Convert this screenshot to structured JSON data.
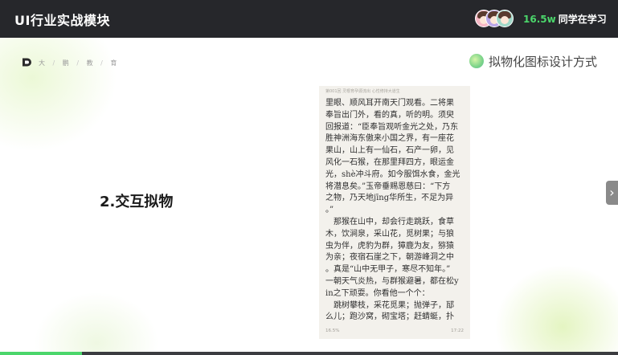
{
  "header": {
    "course_title": "UI行业实战模块",
    "viewer_count": "16.5w",
    "viewer_label": "同学在学习"
  },
  "slide": {
    "breadcrumb": [
      "大",
      "/",
      "鹏",
      "/",
      "教",
      "/",
      "育"
    ],
    "topic": "拟物化图标设计方式",
    "heading": "2.交互拟物",
    "phone": {
      "chapter_header": "第001回 灵根育孕源流出 心性修持大道生",
      "lines": [
        "里眼、顺风耳开南天门观看。二将果",
        "奉旨出门外，看的真，听的明。须臾",
        "回报道：“臣奉旨观听金光之处，乃东",
        "胜神洲海东傲来小国之界，有一座花",
        "果山，山上有一仙石，石产一卵，见",
        "风化一石猴，在那里拜四方，眼运金",
        "光，shè冲斗府。如今服饵水食，金光",
        "将潜息矣。”玉帝垂赐恩慈曰：“下方",
        "之物，乃天地jīng华所生，不足为异",
        "。”",
        "　那猴在山中，却会行走跳跃，食草",
        "木，饮涧泉，采山花，觅树果；与狼",
        "虫为伴，虎豹为群，獐鹿为友，猕猿",
        "为亲；夜宿石崖之下，朝游峰洞之中",
        "。真是“山中无甲子，寒尽不知年。”",
        "一朝天气炎热，与群猴避暑，都在松y",
        "in之下顽耍。你看他一个个：",
        "　跳树攀枝，采花觅果；抛弹子，邷",
        "么儿；跑沙窝，砌宝塔；赶蜻蜓，扑"
      ],
      "reading_progress": "16.5%",
      "clock": "17:22"
    }
  },
  "playback": {
    "progress": 0.133
  },
  "colors": {
    "accent": "#4bd66b",
    "topbar": "#26272b"
  }
}
